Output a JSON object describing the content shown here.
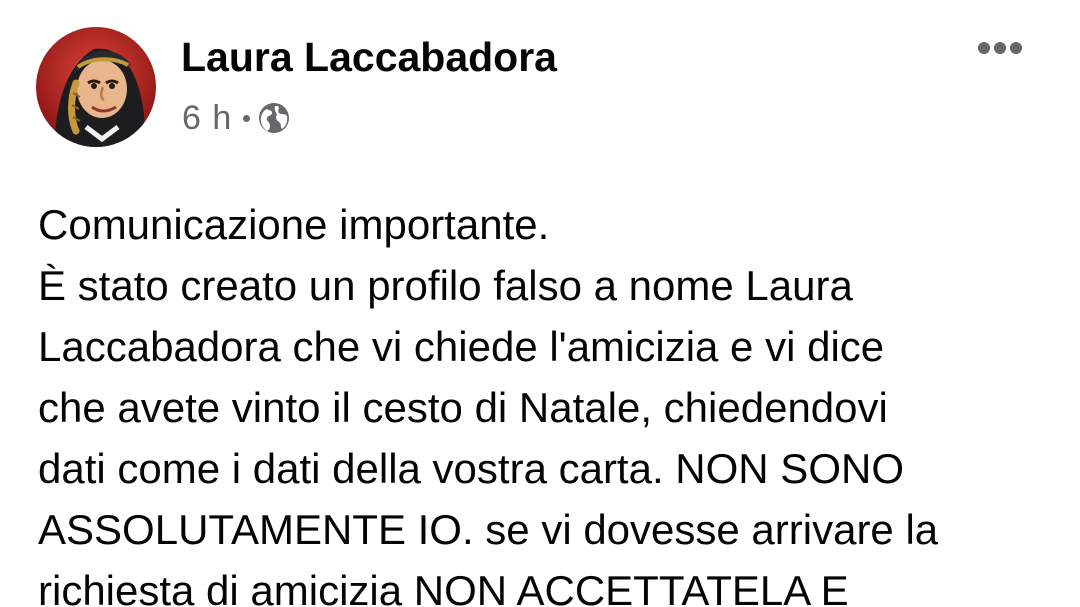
{
  "post": {
    "author": "Laura Laccabadora",
    "timestamp": "6 h",
    "audience_icon": "globe-icon",
    "more_icon": "more-options-icon",
    "lines": [
      "Comunicazione importante.",
      "È stato creato un profilo falso a nome Laura",
      "Laccabadora che vi chiede l'amicizia e vi dice",
      "che avete vinto il cesto di Natale, chiedendovi",
      "dati come i dati della vostra carta. NON SONO",
      "ASSOLUTAMENTE IO. se vi dovesse arrivare la",
      "richiesta di amicizia NON ACCETTATELA E"
    ]
  },
  "colors": {
    "primary_text": "#050505",
    "secondary_text": "#65676b",
    "avatar_background": "#b11e1e"
  }
}
